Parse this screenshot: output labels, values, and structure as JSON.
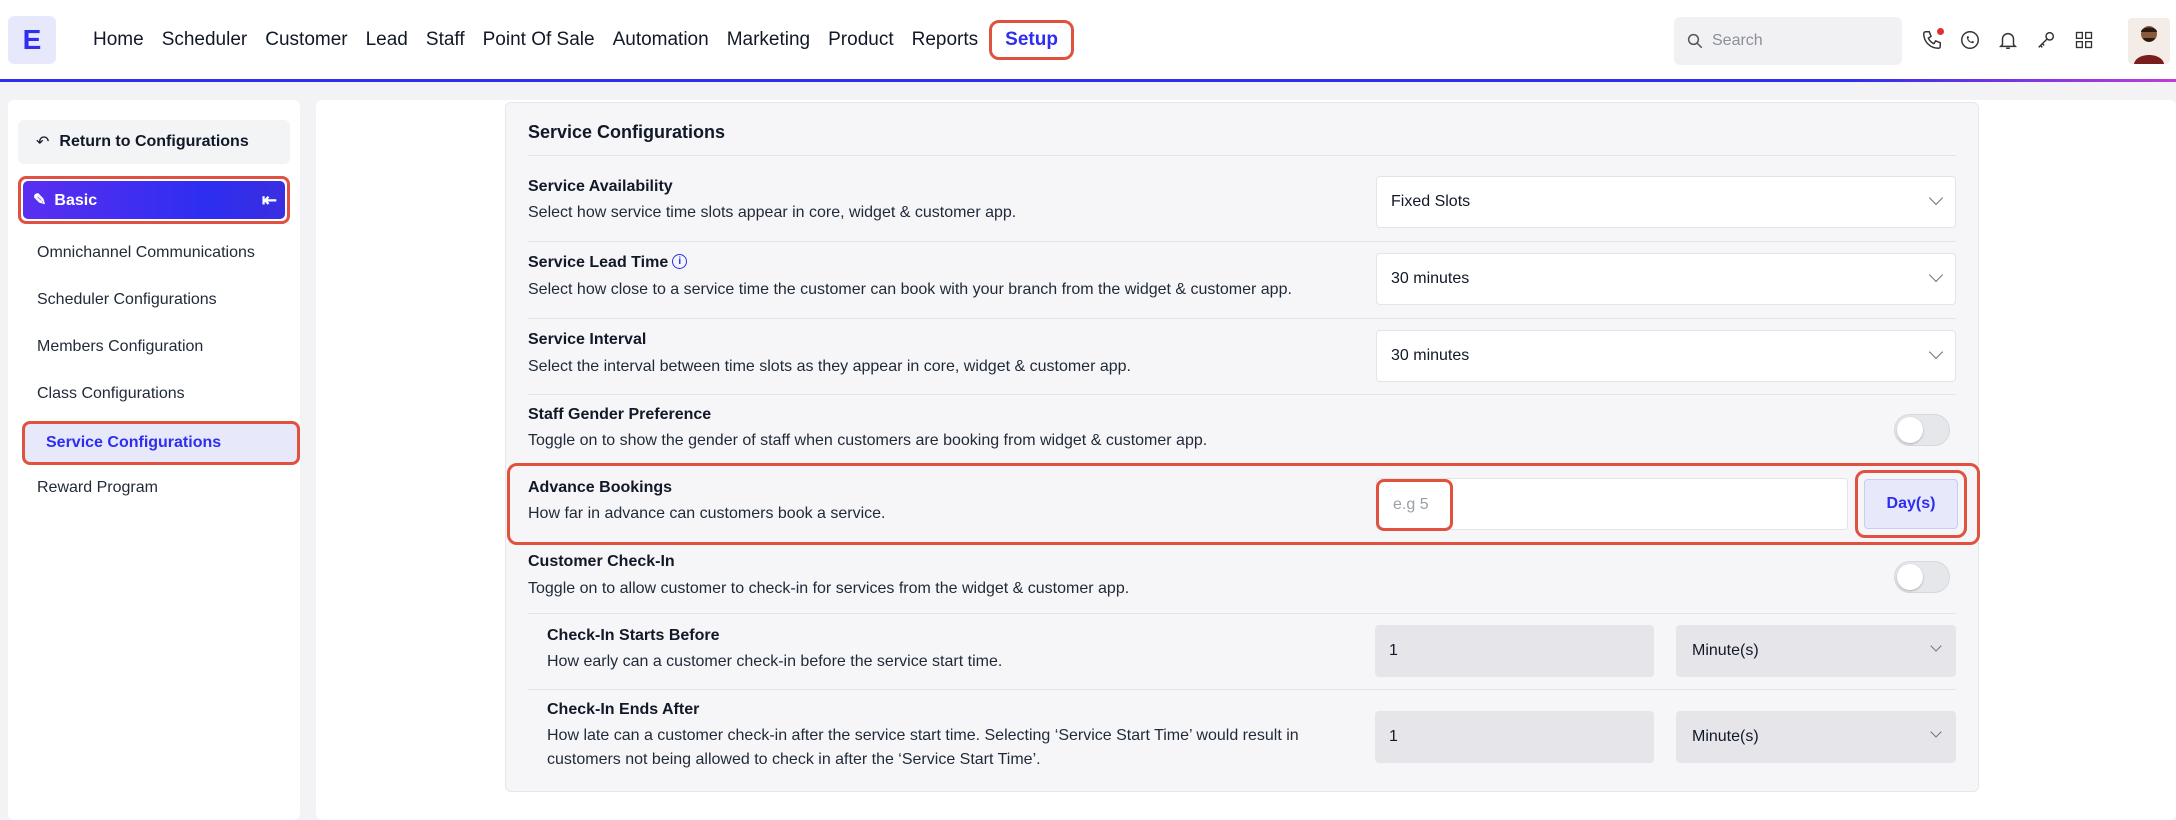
{
  "logo": "E",
  "nav": [
    "Home",
    "Scheduler",
    "Customer",
    "Lead",
    "Staff",
    "Point Of Sale",
    "Automation",
    "Marketing",
    "Product",
    "Reports"
  ],
  "nav_active": "Setup",
  "search": {
    "placeholder": "Search"
  },
  "sidebar": {
    "return_label": "Return to Configurations",
    "section_label": "Basic",
    "items": [
      "Omnichannel Communications",
      "Scheduler Configurations",
      "Members Configuration",
      "Class Configurations"
    ],
    "active_item": "Service Configurations",
    "last_item": "Reward Program"
  },
  "card": {
    "title": "Service Configurations",
    "availability": {
      "label": "Service Availability",
      "desc": "Select how service time slots appear in core, widget & customer app.",
      "value": "Fixed Slots"
    },
    "lead_time": {
      "label": "Service Lead Time",
      "desc": "Select how close to a service time the customer can book with your branch from the widget & customer app.",
      "value": "30 minutes"
    },
    "interval": {
      "label": "Service Interval",
      "desc": "Select the interval between time slots as they appear in core, widget & customer app.",
      "value": "30 minutes"
    },
    "gender": {
      "label": "Staff Gender Preference",
      "desc": "Toggle on to show the gender of staff when customers are booking from widget & customer app.",
      "on": false
    },
    "advance": {
      "label": "Advance Bookings",
      "desc": "How far in advance can customers book a service.",
      "placeholder": "e.g 5",
      "unit": "Day(s)"
    },
    "checkin": {
      "label": "Customer Check-In",
      "desc": "Toggle on to allow customer to check-in for services from the widget & customer app.",
      "on": false
    },
    "starts_before": {
      "label": "Check-In Starts Before",
      "desc": "How early can a customer check-in before the service start time.",
      "value": "1",
      "unit": "Minute(s)"
    },
    "ends_after": {
      "label": "Check-In Ends After",
      "desc1": "How late can a customer check-in after the service start time. Selecting ‘Service Start Time’ would result in",
      "desc2": "customers not being allowed to check in after the ‘Service Start Time’.",
      "value": "1",
      "unit": "Minute(s)"
    }
  },
  "colors": {
    "accent": "#2d2ef0",
    "highlight": "#e0523f"
  }
}
